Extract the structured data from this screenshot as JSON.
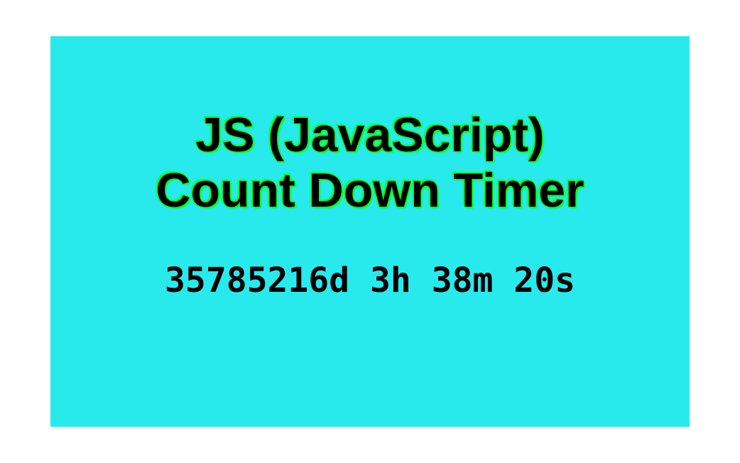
{
  "title_line1": "JS (JavaScript)",
  "title_line2": "Count Down Timer",
  "countdown": {
    "full_text": "35785216d 3h 38m 20s",
    "days": 35785216,
    "hours": 3,
    "minutes": 38,
    "seconds": 20
  },
  "colors": {
    "background": "#ffffff",
    "panel": "#28eaec",
    "text": "#000000",
    "glow": "#00ff00"
  }
}
